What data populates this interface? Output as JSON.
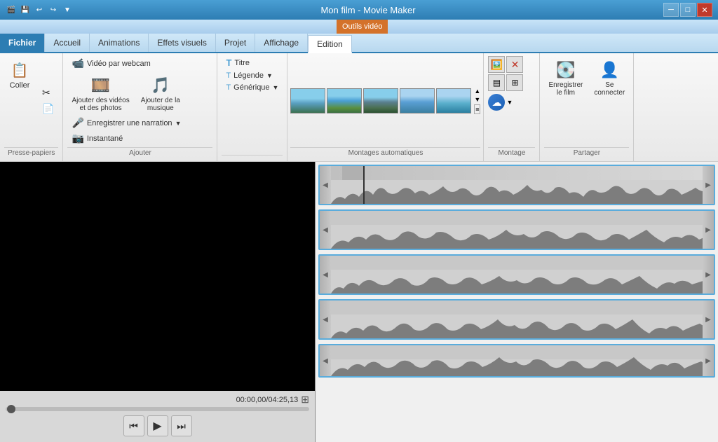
{
  "titleBar": {
    "title": "Mon film - Movie Maker",
    "quickAccess": [
      "💾",
      "↩",
      "↪",
      "▼"
    ]
  },
  "outils": {
    "label": "Outils vidéo"
  },
  "tabs": {
    "items": [
      {
        "id": "fichier",
        "label": "Fichier",
        "active": false,
        "isFile": true
      },
      {
        "id": "accueil",
        "label": "Accueil",
        "active": false
      },
      {
        "id": "animations",
        "label": "Animations",
        "active": false
      },
      {
        "id": "effets-visuels",
        "label": "Effets visuels",
        "active": false
      },
      {
        "id": "projet",
        "label": "Projet",
        "active": false
      },
      {
        "id": "affichage",
        "label": "Affichage",
        "active": false
      },
      {
        "id": "edition",
        "label": "Edition",
        "active": true
      }
    ]
  },
  "ribbon": {
    "groups": {
      "pressePapiers": {
        "label": "Presse-papiers",
        "coller": "Coller",
        "couper": "✂"
      },
      "ajouter": {
        "label": "Ajouter",
        "videoWebcam": "Vidéo par webcam",
        "ajouterVideos": "Ajouter des vidéos\net des photos",
        "ajouterMusique": "Ajouter de la\nmusique",
        "enregistrerNarration": "Enregistrer une narration",
        "instantane": "Instantané"
      },
      "insertions": {
        "titre": "Titre",
        "legende": "Légende",
        "generique": "Générique"
      },
      "montagesAuto": {
        "label": "Montages automatiques"
      },
      "montage": {
        "label": "Montage"
      },
      "partager": {
        "label": "Partager",
        "enregistrerFilm": "Enregistrer\nle film",
        "seConnecter": "Se\nconnecter"
      }
    }
  },
  "preview": {
    "timeDisplay": "00:00,00/04:25,13"
  },
  "timeline": {
    "strips": [
      {
        "id": "strip-1",
        "hasPlayhead": true
      },
      {
        "id": "strip-2",
        "hasPlayhead": false
      },
      {
        "id": "strip-3",
        "hasPlayhead": false
      },
      {
        "id": "strip-4",
        "hasPlayhead": false
      },
      {
        "id": "strip-5",
        "hasPlayhead": false
      }
    ]
  }
}
